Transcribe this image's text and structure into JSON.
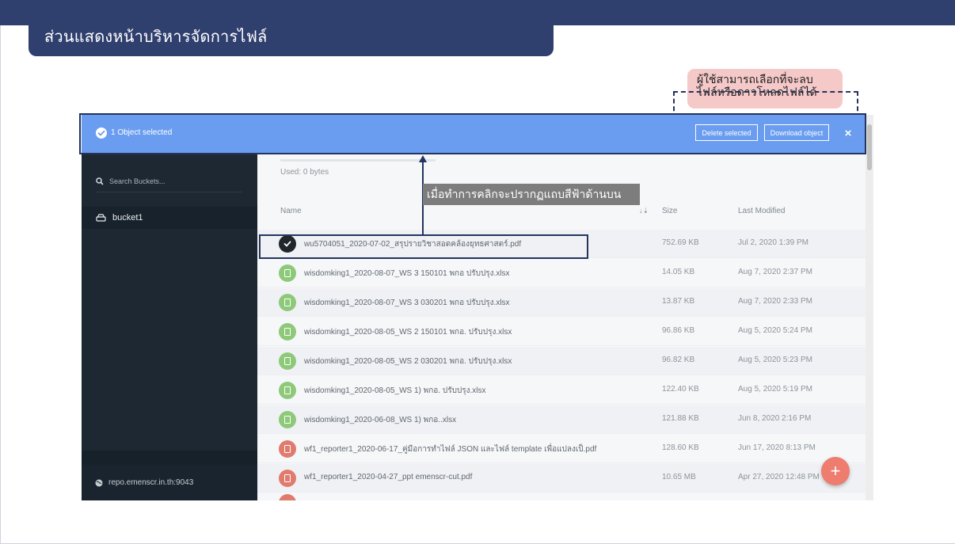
{
  "slide": {
    "title": "ส่วนแสดงหน้าบริหารจัดการไฟล์",
    "callout_line1": "ผู้ใช้สามารถเลือกที่จะลบ",
    "callout_line2": "ไฟล์หรือดาวโหลดไฟล์ได้",
    "note": "เมื่อทำการคลิกจะปรากฏแถบสีฟ้าด้านบน"
  },
  "selection_bar": {
    "text": "1 Object selected",
    "delete_label": "Delete selected",
    "download_label": "Download object",
    "close_label": "×"
  },
  "sidebar": {
    "search_placeholder": "Search Buckets...",
    "bucket": "bucket1",
    "host": "repo.emenscr.in.th:9043"
  },
  "content": {
    "used": "Used: 0 bytes",
    "columns": {
      "name": "Name",
      "sort": "↓⇣",
      "size": "Size",
      "modified": "Last Modified"
    },
    "files": [
      {
        "name": "wu5704051_2020-07-02_สรุปรายวิชาสอดคล้องยุทธศาสตร์.pdf",
        "size": "752.69 KB",
        "modified": "Jul 2, 2020 1:39 PM",
        "type": "selected"
      },
      {
        "name": "wisdomking1_2020-08-07_WS 3 150101 พกอ ปรับปรุง.xlsx",
        "size": "14.05 KB",
        "modified": "Aug 7, 2020 2:37 PM",
        "type": "xlsx"
      },
      {
        "name": "wisdomking1_2020-08-07_WS 3 030201 พกอ ปรับปรุง.xlsx",
        "size": "13.87 KB",
        "modified": "Aug 7, 2020 2:33 PM",
        "type": "xlsx"
      },
      {
        "name": "wisdomking1_2020-08-05_WS 2 150101 พกอ. ปรับปรุง.xlsx",
        "size": "96.86 KB",
        "modified": "Aug 5, 2020 5:24 PM",
        "type": "xlsx"
      },
      {
        "name": "wisdomking1_2020-08-05_WS 2 030201 พกอ. ปรับปรุง.xlsx",
        "size": "96.82 KB",
        "modified": "Aug 5, 2020 5:23 PM",
        "type": "xlsx"
      },
      {
        "name": "wisdomking1_2020-08-05_WS 1) พกอ. ปรับปรุง.xlsx",
        "size": "122.40 KB",
        "modified": "Aug 5, 2020 5:19 PM",
        "type": "xlsx"
      },
      {
        "name": "wisdomking1_2020-06-08_WS 1) พกอ..xlsx",
        "size": "121.88 KB",
        "modified": "Jun 8, 2020 2:16 PM",
        "type": "xlsx"
      },
      {
        "name": "wf1_reporter1_2020-06-17_คู่มือการทำไฟล์ JSON และไฟล์ template เพื่อแปลงเป็.pdf",
        "size": "128.60 KB",
        "modified": "Jun 17, 2020 8:13 PM",
        "type": "pdf"
      },
      {
        "name": "wf1_reporter1_2020-04-27_ppt emenscr-cut.pdf",
        "size": "10.65 MB",
        "modified": "Apr 27, 2020 12:48 PM",
        "type": "pdf"
      }
    ]
  },
  "colors": {
    "header_navy": "#2f3f6e",
    "selection_blue": "#6a9df0",
    "sidebar_dark": "#1d2833",
    "xlsx_green": "#8ec97a",
    "pdf_red": "#e07b6e",
    "fab_red": "#ee7c6f"
  },
  "icons": {
    "check": "check-icon",
    "search": "search-icon",
    "bucket": "drive-icon",
    "globe": "globe-icon",
    "close": "close-icon",
    "add": "plus-icon"
  }
}
